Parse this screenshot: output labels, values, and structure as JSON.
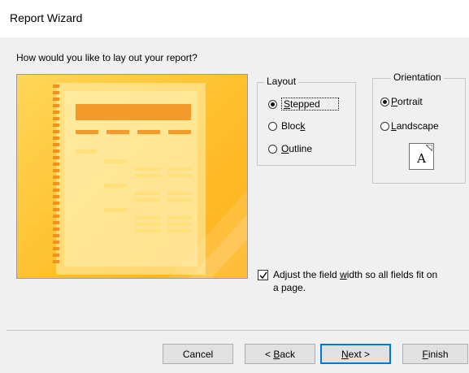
{
  "window": {
    "title": "Report Wizard"
  },
  "prompt": "How would you like to lay out your report?",
  "layout": {
    "label": "Layout",
    "options": [
      {
        "pre": "",
        "key": "S",
        "post": "tepped",
        "checked": true
      },
      {
        "pre": "Bloc",
        "key": "k",
        "post": "",
        "checked": false
      },
      {
        "pre": "",
        "key": "O",
        "post": "utline",
        "checked": false
      }
    ]
  },
  "orientation": {
    "label": "Orientation",
    "options": [
      {
        "pre": "",
        "key": "P",
        "post": "ortrait",
        "checked": true
      },
      {
        "pre": "",
        "key": "L",
        "post": "andscape",
        "checked": false
      }
    ],
    "icon_letter": "A"
  },
  "adjust_width": {
    "checked": true,
    "pre": "Adjust the field ",
    "key": "w",
    "post": "idth so all fields fit on",
    "line2": "a page."
  },
  "buttons": {
    "cancel": "Cancel",
    "back_pre": "< ",
    "back_key": "B",
    "back_post": "ack",
    "next_key": "N",
    "next_post": "ext >",
    "finish_key": "F",
    "finish_post": "inish"
  },
  "colors": {
    "preview_bg": "#ffc23a",
    "accent": "#0078d7",
    "preview_bar": "#f49a2a"
  }
}
